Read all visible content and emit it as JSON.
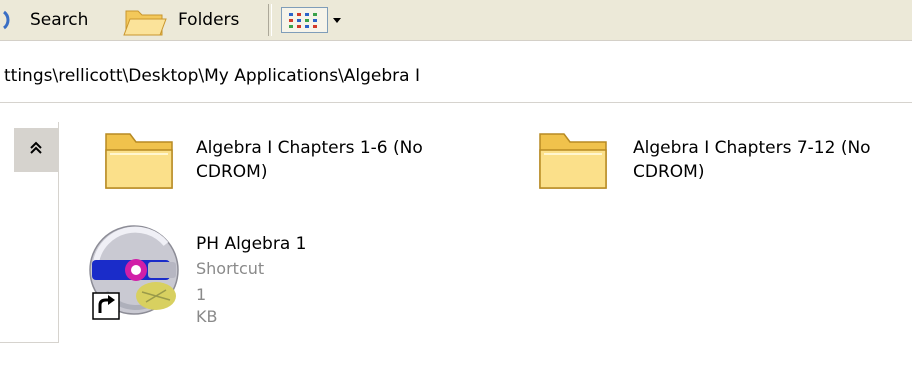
{
  "toolbar": {
    "search_label": "Search",
    "folders_label": "Folders",
    "search_icon": "search-icon",
    "folder_icon": "folder-icon",
    "views_icon": "views-icon"
  },
  "address": {
    "path": "ttings\\rellicott\\Desktop\\My Applications\\Algebra I"
  },
  "tasks_pane": {
    "collapse_icon": "double-chevron-up-icon"
  },
  "items": [
    {
      "name_line1": "Algebra I Chapters 1-6 (No",
      "name_line2": "CDROM)",
      "type": "folder"
    },
    {
      "name_line1": "Algebra I Chapters 7-12 (No",
      "name_line2": "CDROM)",
      "type": "folder"
    },
    {
      "name": "PH Algebra 1",
      "kind": "Shortcut",
      "size": "1 KB",
      "type": "shortcut"
    }
  ],
  "colors": {
    "toolbar_bg": "#ece9d8",
    "folder_yellow": "#f8d775",
    "meta_gray": "#8a8a8a"
  }
}
